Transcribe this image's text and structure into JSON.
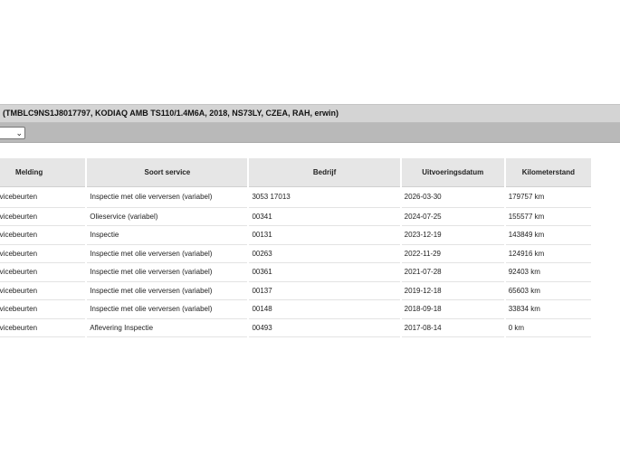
{
  "vehicle": {
    "title": "(TMBLC9NS1J8017797, KODIAQ AMB TS110/1.4M6A, 2018, NS73LY, CZEA, RAH, erwin)"
  },
  "filter": {
    "selected_value": "",
    "chevron": "⌄"
  },
  "table": {
    "headers": {
      "melding": "Melding",
      "soort": "Soort service",
      "bedrijf": "Bedrijf",
      "datum": "Uitvoeringsdatum",
      "km": "Kilometerstand"
    },
    "rows": [
      {
        "melding": "Alle servicebeurten",
        "soort": "Inspectie met olie verversen (variabel)",
        "bedrijf": "3053 17013",
        "datum": "2026-03-30",
        "km": "179757 km"
      },
      {
        "melding": "Alle servicebeurten",
        "soort": "Olieservice (variabel)",
        "bedrijf": "00341",
        "datum": "2024-07-25",
        "km": "155577 km"
      },
      {
        "melding": "Alle servicebeurten",
        "soort": "Inspectie",
        "bedrijf": "00131",
        "datum": "2023-12-19",
        "km": "143849 km"
      },
      {
        "melding": "Alle servicebeurten",
        "soort": "Inspectie met olie verversen (variabel)",
        "bedrijf": "00263",
        "datum": "2022-11-29",
        "km": "124916 km"
      },
      {
        "melding": "Alle servicebeurten",
        "soort": "Inspectie met olie verversen (variabel)",
        "bedrijf": "00361",
        "datum": "2021-07-28",
        "km": "92403 km"
      },
      {
        "melding": "Alle servicebeurten",
        "soort": "Inspectie met olie verversen (variabel)",
        "bedrijf": "00137",
        "datum": "2019-12-18",
        "km": "65603 km"
      },
      {
        "melding": "Alle servicebeurten",
        "soort": "Inspectie met olie verversen (variabel)",
        "bedrijf": "00148",
        "datum": "2018-09-18",
        "km": "33834 km"
      },
      {
        "melding": "Alle servicebeurten",
        "soort": "Aflevering Inspectie",
        "bedrijf": "00493",
        "datum": "2017-08-14",
        "km": "0 km"
      }
    ]
  }
}
